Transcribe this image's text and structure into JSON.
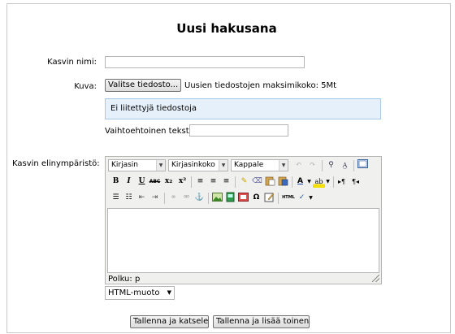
{
  "page": {
    "title": "Uusi hakusana"
  },
  "form": {
    "name_label": "Kasvin nimi:",
    "name_value": "",
    "image_label": "Kuva:",
    "choose_file_button": "Valitse tiedosto...",
    "max_size_text": "Uusien tiedostojen maksimikoko: 5Mt",
    "no_files_text": "Ei liitettyjä tiedostoja",
    "alt_text_label": "Vaihtoehtoinen teksti",
    "alt_text_value": "",
    "environment_label": "Kasvin elinympäristö:"
  },
  "editor": {
    "font_family": "Kirjasin",
    "font_size": "Kirjasinkoko",
    "paragraph": "Kappale",
    "path_text": "Polku: p",
    "format_select": "HTML-muoto",
    "toolbar": {
      "bold": "B",
      "italic": "I",
      "underline": "U",
      "strike": "ABC",
      "subscript": "x₂",
      "superscript": "x²",
      "omega": "Ω"
    }
  },
  "actions": {
    "save_and_view": "Tallenna ja katsele",
    "save_and_add": "Tallenna ja lisää toinen"
  }
}
